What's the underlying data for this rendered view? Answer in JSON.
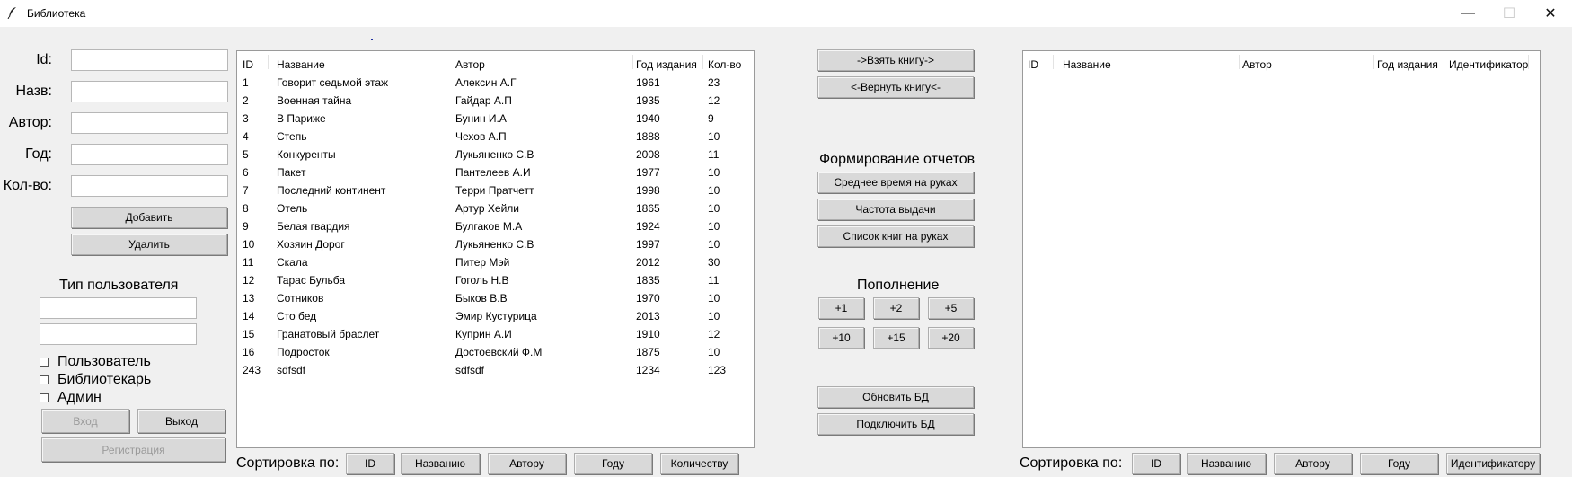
{
  "window": {
    "title": "Библиотека",
    "minimize": "—",
    "maximize": "☐",
    "close": "✕"
  },
  "form": {
    "labels": {
      "id": "Id:",
      "name": "Назв:",
      "author": "Автор:",
      "year": "Год:",
      "count": "Кол-во:"
    },
    "values": {
      "id": "",
      "name": "",
      "author": "",
      "year": "",
      "count": ""
    },
    "add_button": "Добавить",
    "delete_button": "Удалить"
  },
  "user": {
    "heading": "Тип пользователя",
    "login_value": "",
    "password_value": "",
    "roles": [
      {
        "label": "Пользователь",
        "checked": false
      },
      {
        "label": "Библиотекарь",
        "checked": false
      },
      {
        "label": "Админ",
        "checked": false
      }
    ],
    "login_button": "Вход",
    "exit_button": "Выход",
    "register_button": "Регистрация"
  },
  "books_table": {
    "columns": [
      "ID",
      "Название",
      "Автор",
      "Год издания",
      "Кол-во"
    ],
    "rows": [
      [
        "1",
        "Говорит седьмой этаж",
        "Алексин А.Г",
        "1961",
        "23"
      ],
      [
        "2",
        "Военная тайна",
        "Гайдар А.П",
        "1935",
        "12"
      ],
      [
        "3",
        "В Париже",
        "Бунин И.А",
        "1940",
        "9"
      ],
      [
        "4",
        "Степь",
        "Чехов А.П",
        "1888",
        "10"
      ],
      [
        "5",
        "Конкуренты",
        "Лукьяненко С.В",
        "2008",
        "11"
      ],
      [
        "6",
        "Пакет",
        "Пантелеев А.И",
        "1977",
        "10"
      ],
      [
        "7",
        "Последний континент",
        "Терри Пратчетт",
        "1998",
        "10"
      ],
      [
        "8",
        "Отель",
        "Артур Хейли",
        "1865",
        "10"
      ],
      [
        "9",
        "Белая гвардия",
        "Булгаков М.А",
        "1924",
        "10"
      ],
      [
        "10",
        "Хозяин Дорог",
        "Лукьяненко С.В",
        "1997",
        "10"
      ],
      [
        "11",
        "Скала",
        "Питер Мэй",
        "2012",
        "30"
      ],
      [
        "12",
        "Тарас Бульба",
        "Гоголь Н.В",
        "1835",
        "11"
      ],
      [
        "13",
        "Сотников",
        "Быков В.В",
        "1970",
        "10"
      ],
      [
        "14",
        "Сто бед",
        "Эмир Кустурица",
        "2013",
        "10"
      ],
      [
        "15",
        "Гранатовый браслет",
        "Куприн А.И",
        "1910",
        "12"
      ],
      [
        "16",
        "Подросток",
        "Достоевский Ф.М",
        "1875",
        "10"
      ],
      [
        "243",
        "sdfsdf",
        "sdfsdf",
        "1234",
        "123"
      ]
    ],
    "sort_label": "Сортировка по:",
    "sort_buttons": [
      "ID",
      "Названию",
      "Автору",
      "Году",
      "Количеству"
    ]
  },
  "middle": {
    "take_book": "->Взять книгу->",
    "return_book": "<-Вернуть книгу<-",
    "reports_heading": "Формирование отчетов",
    "report_buttons": [
      "Среднее время на руках",
      "Частота выдачи",
      "Список книг на руках"
    ],
    "restock_heading": "Пополнение",
    "restock_buttons": [
      "+1",
      "+2",
      "+5",
      "+10",
      "+15",
      "+20"
    ],
    "update_db": "Обновить БД",
    "connect_db": "Подключить БД"
  },
  "taken_table": {
    "columns": [
      "ID",
      "Название",
      "Автор",
      "Год издания",
      "Идентификатор"
    ],
    "rows": [],
    "sort_label": "Сортировка по:",
    "sort_buttons": [
      "ID",
      "Названию",
      "Автору",
      "Году",
      "Идентификатору"
    ]
  }
}
